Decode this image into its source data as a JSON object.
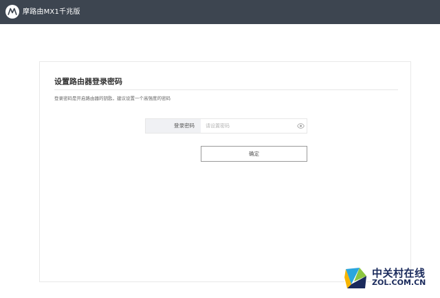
{
  "header": {
    "app_title": "摩路由MX1千兆版",
    "logo_icon": "motorola-logo-icon"
  },
  "form": {
    "title": "设置路由器登录密码",
    "description": "登录密码是开启路由器的钥匙，建议设置一个高强度的密码",
    "password_label": "登录密码",
    "password_placeholder": "请设置密码",
    "password_value": "",
    "visibility_icon": "eye-icon",
    "confirm_label": "确定"
  },
  "watermark": {
    "chinese": "中关村在线",
    "english": "ZOL.COM.CN"
  },
  "colors": {
    "topbar": "#3d4550",
    "label_bg": "#f0f1f4",
    "watermark_text": "#1a2a5c"
  }
}
